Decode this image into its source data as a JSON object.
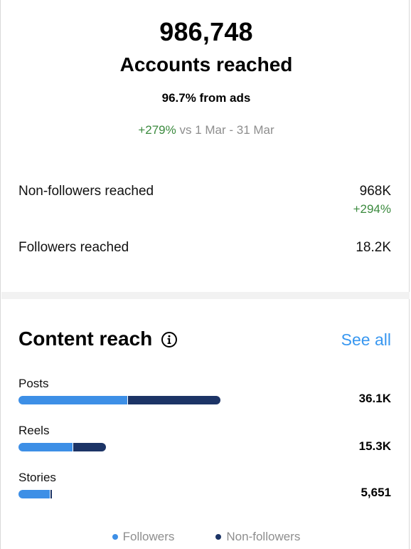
{
  "summary": {
    "accounts_count": "986,748",
    "accounts_label": "Accounts reached",
    "ads_text": "96.7% from ads",
    "change_pct": "+279%",
    "compare_text": "vs 1 Mar - 31 Mar"
  },
  "breakdown": {
    "non_followers_label": "Non-followers reached",
    "non_followers_value": "968K",
    "non_followers_delta": "+294%",
    "followers_label": "Followers reached",
    "followers_value": "18.2K"
  },
  "content_reach": {
    "title": "Content reach",
    "info_icon": "info-circle-icon",
    "see_all_label": "See all",
    "items": [
      {
        "label": "Posts",
        "value": "36.1K",
        "followers_fraction": 0.54,
        "non_followers_fraction": 0.46
      },
      {
        "label": "Reels",
        "value": "15.3K",
        "followers_fraction": 0.62,
        "non_followers_fraction": 0.38
      },
      {
        "label": "Stories",
        "value": "5,651",
        "followers_fraction": 0.96,
        "non_followers_fraction": 0.04
      }
    ],
    "legend": {
      "followers": "Followers",
      "non_followers": "Non-followers"
    }
  },
  "colors": {
    "followers": "#3d8fe6",
    "non_followers": "#1c3466",
    "positive": "#3b8a3e",
    "link": "#3897f0"
  }
}
